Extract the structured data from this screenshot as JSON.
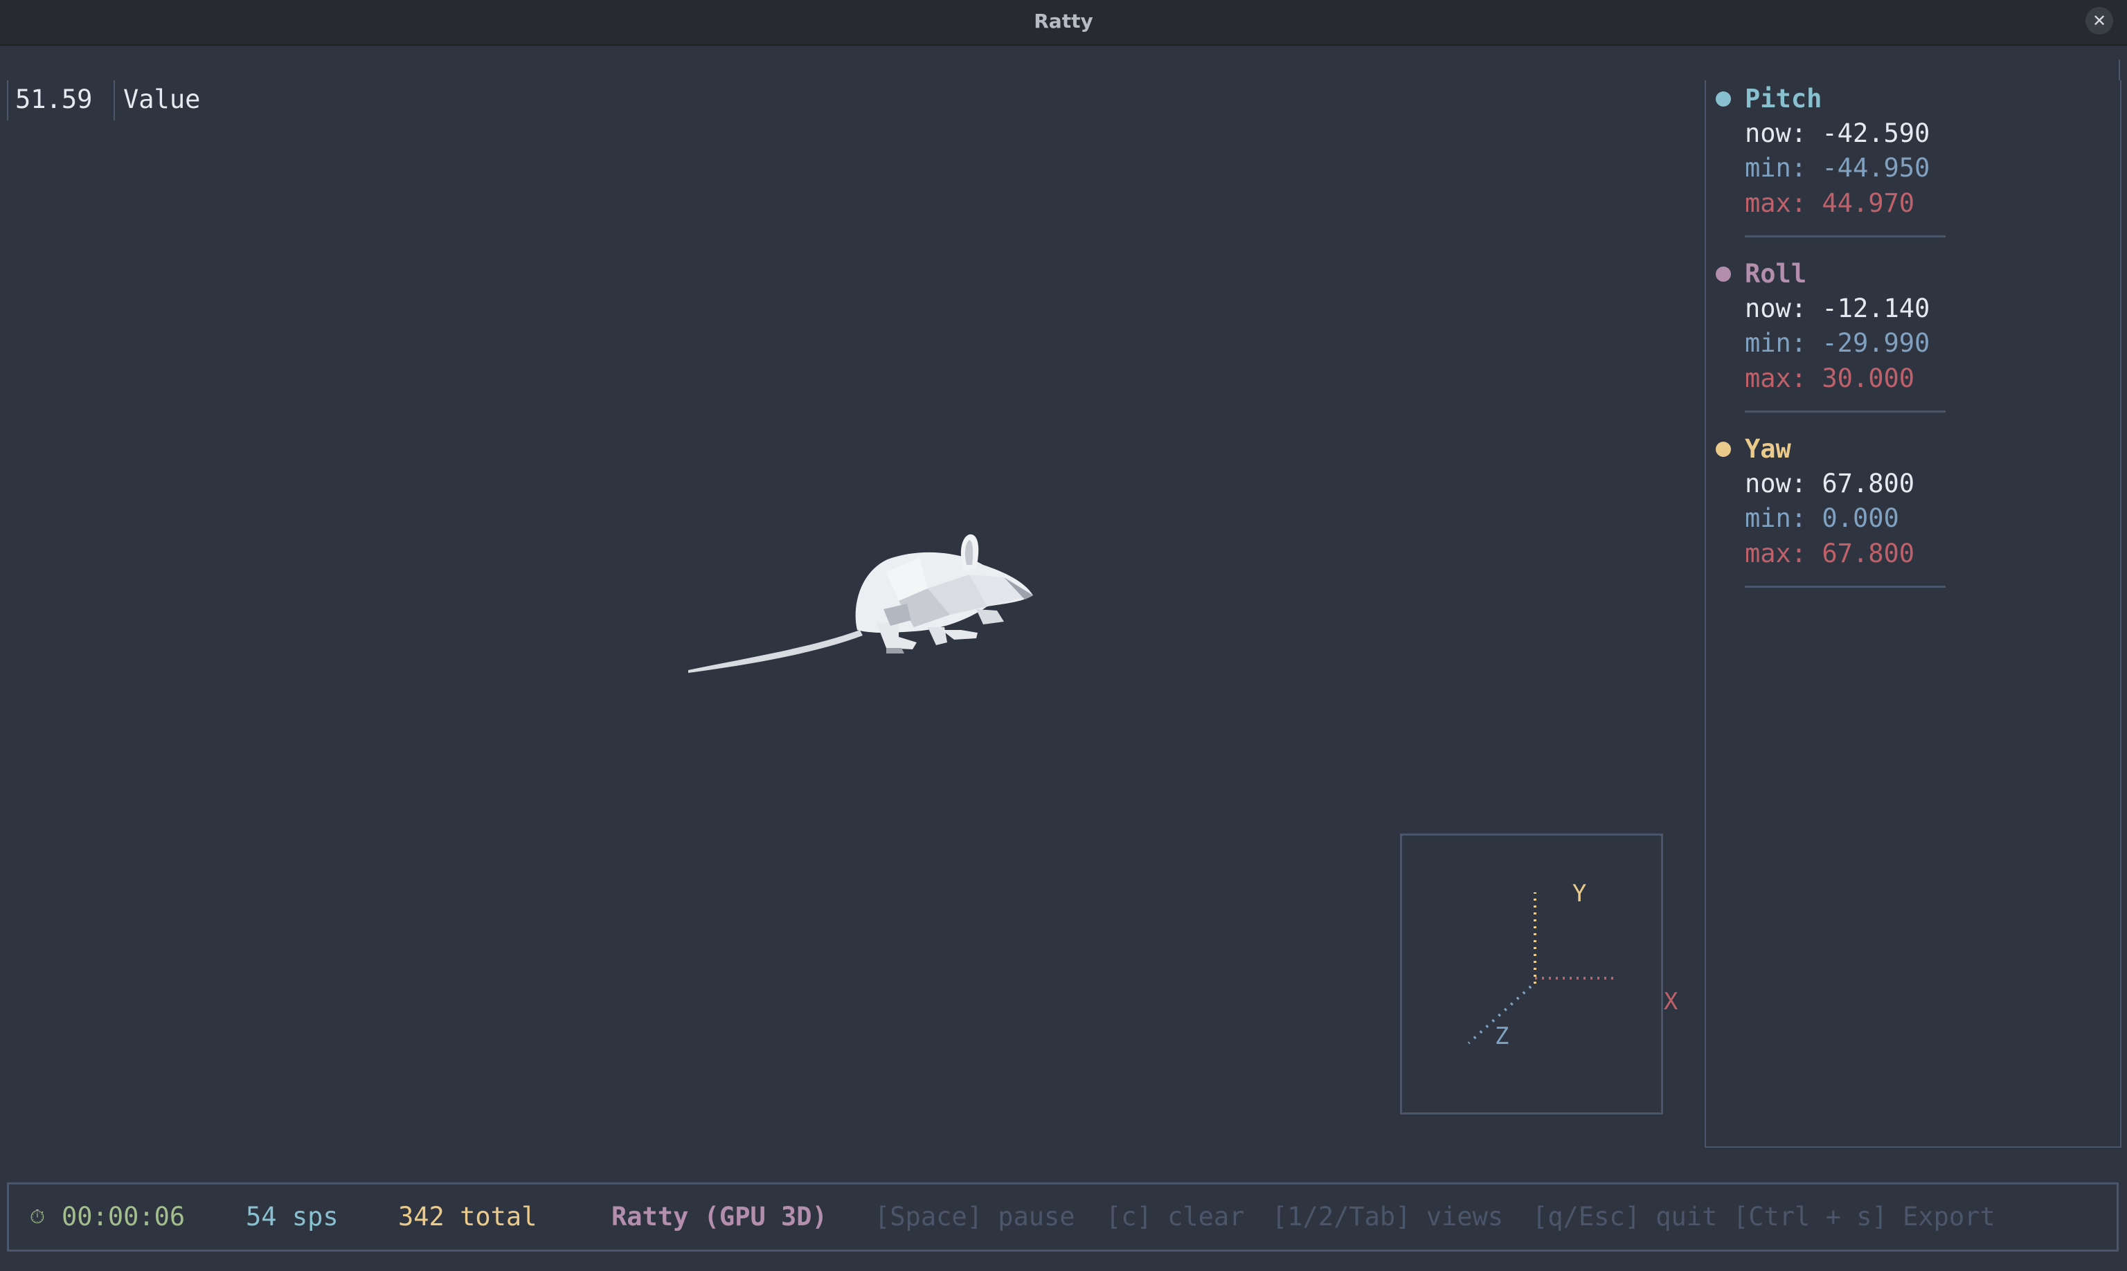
{
  "window": {
    "title": "Ratty",
    "close_glyph": "✕"
  },
  "top_readout": {
    "value": "51.59",
    "label": "Value"
  },
  "side_panel": {
    "groups": [
      {
        "name": "Pitch",
        "color": "#88c0d0",
        "now_label": "now:",
        "now_value": "-42.590",
        "min_label": "min:",
        "min_value": "-44.950",
        "max_label": "max:",
        "max_value": "44.970"
      },
      {
        "name": "Roll",
        "color": "#b48ead",
        "now_label": "now:",
        "now_value": "-12.140",
        "min_label": "min:",
        "min_value": "-29.990",
        "max_label": "max:",
        "max_value": "30.000"
      },
      {
        "name": "Yaw",
        "color": "#ebcb8b",
        "now_label": "now:",
        "now_value": "67.800",
        "min_label": "min:",
        "min_value": "0.000",
        "max_label": "max:",
        "max_value": "67.800"
      }
    ],
    "min_color": "#81a1c1",
    "max_color": "#bf616a"
  },
  "axes_gizmo": {
    "x_label": "X",
    "y_label": "Y",
    "z_label": "Z",
    "x_color": "#bf616a",
    "y_color": "#ebcb8b",
    "z_color": "#81a1c1"
  },
  "status_bar": {
    "timer_icon": "stopwatch-icon",
    "timer": "00:00:06",
    "rate_icon": "people-icon",
    "rate": "54 sps",
    "total_icon": "database-icon",
    "total": "342 total",
    "mode_icon": "monitor-icon",
    "mode": "Ratty (GPU 3D)",
    "hints": [
      "[Space] pause",
      "[c] clear",
      "[1/2/Tab] views",
      "[q/Esc] quit",
      "[Ctrl + s] Export"
    ]
  }
}
